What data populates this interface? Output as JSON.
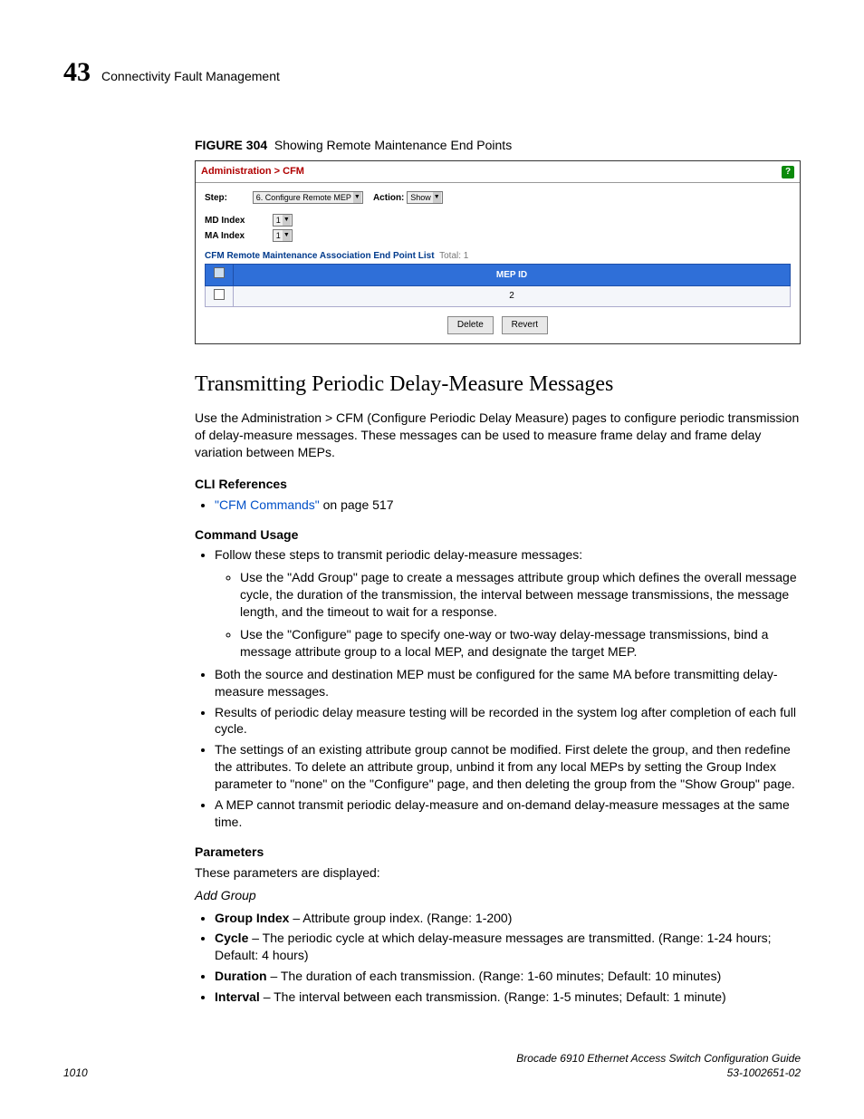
{
  "header": {
    "chapter_number": "43",
    "chapter_title": "Connectivity Fault Management"
  },
  "figure": {
    "label": "FIGURE 304",
    "caption": "Showing Remote Maintenance End Points",
    "breadcrumb": "Administration > CFM",
    "step_label": "Step:",
    "step_value": "6. Configure Remote MEP",
    "action_label": "Action:",
    "action_value": "Show",
    "md_index_label": "MD Index",
    "md_index_value": "1",
    "ma_index_label": "MA Index",
    "ma_index_value": "1",
    "list_title": "CFM Remote Maintenance Association End Point List",
    "total_label": "Total:",
    "total_value": "1",
    "col_mepid": "MEP ID",
    "row_mepid": "2",
    "btn_delete": "Delete",
    "btn_revert": "Revert"
  },
  "section": {
    "title": "Transmitting Periodic Delay-Measure Messages",
    "intro": "Use the Administration > CFM (Configure Periodic Delay Measure) pages to configure periodic transmission of delay-measure messages. These messages can be used to measure frame delay and frame delay variation between MEPs."
  },
  "cli": {
    "heading": "CLI References",
    "link_text": "\"CFM Commands\"",
    "link_suffix": " on page 517"
  },
  "usage": {
    "heading": "Command Usage",
    "u1": "Follow these steps to transmit periodic delay-measure messages:",
    "u1a": "Use the \"Add Group\" page to create a messages attribute group which defines the overall message cycle, the duration of the transmission, the interval between message transmissions, the message length, and the timeout to wait for a response.",
    "u1b": "Use the \"Configure\" page to specify one-way or two-way delay-message transmissions, bind a message attribute group to a local MEP, and designate the target MEP.",
    "u2": "Both the source and destination MEP must be configured for the same MA before transmitting delay-measure messages.",
    "u3": "Results of periodic delay measure testing will be recorded in the system log after completion of each full cycle.",
    "u4": "The settings of an existing attribute group cannot be modified. First delete the group, and then redefine the attributes. To delete an attribute group, unbind it from any local MEPs by setting the Group Index parameter to \"none\" on the \"Configure\" page, and then deleting the group from the \"Show Group\" page.",
    "u5": "A MEP cannot transmit periodic delay-measure and on-demand delay-measure messages at the same time."
  },
  "params": {
    "heading": "Parameters",
    "intro": "These parameters are displayed:",
    "group_heading": "Add Group",
    "p1_name": "Group Index",
    "p1_desc": " – Attribute group index. (Range: 1-200)",
    "p2_name": "Cycle",
    "p2_desc": " – The periodic cycle at which delay-measure messages are transmitted. (Range: 1-24 hours; Default: 4 hours)",
    "p3_name": "Duration",
    "p3_desc": " – The duration of each transmission. (Range: 1-60 minutes; Default: 10 minutes)",
    "p4_name": "Interval",
    "p4_desc": " – The interval between each transmission. (Range: 1-5 minutes; Default: 1 minute)"
  },
  "footer": {
    "page": "1010",
    "book": "Brocade 6910 Ethernet Access Switch Configuration Guide",
    "docnum": "53-1002651-02"
  }
}
